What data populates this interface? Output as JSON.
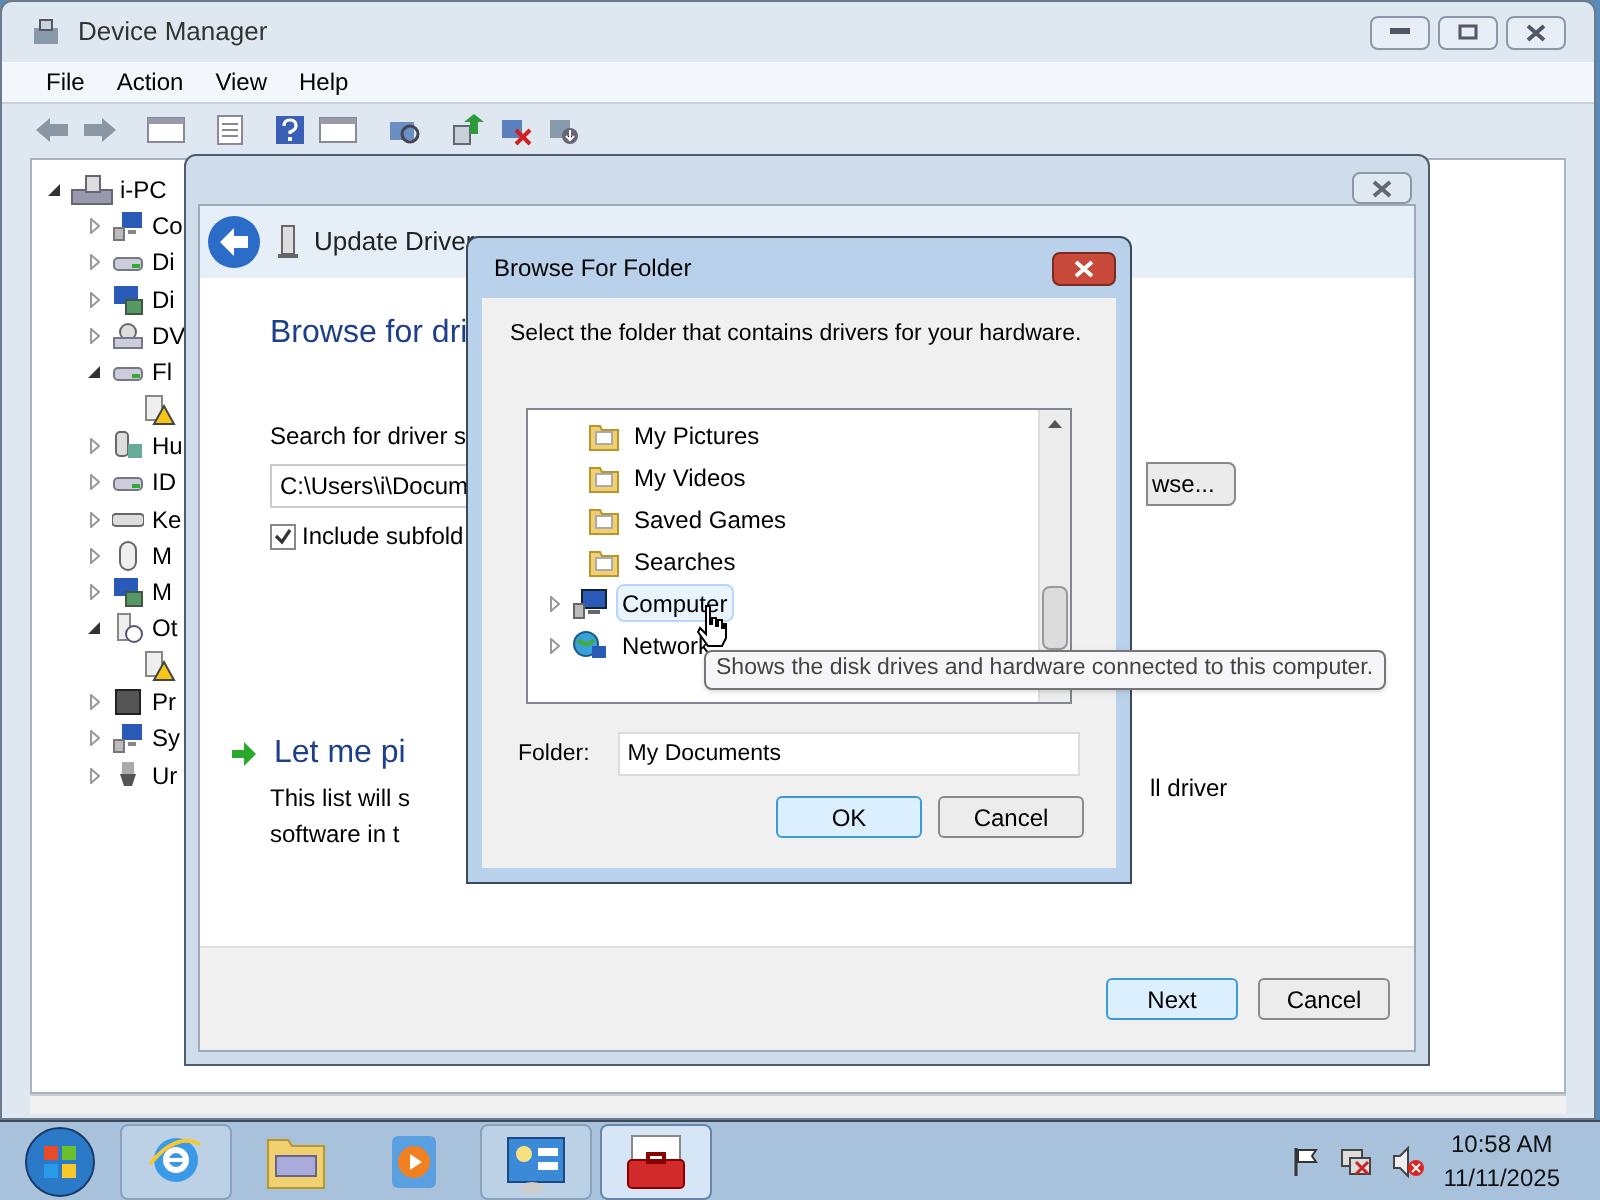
{
  "device_manager": {
    "title": "Device Manager",
    "menu": [
      "File",
      "Action",
      "View",
      "Help"
    ],
    "tree": {
      "label": "i-PC",
      "expanded": true,
      "children": [
        {
          "label": "Co",
          "kind": "computer",
          "expanded": false
        },
        {
          "label": "Di",
          "kind": "drive",
          "expanded": false
        },
        {
          "label": "Di",
          "kind": "display",
          "expanded": false
        },
        {
          "label": "DV",
          "kind": "dvd",
          "expanded": false
        },
        {
          "label": "Fl",
          "kind": "drive",
          "expanded": true,
          "children": [
            {
              "warning": true
            }
          ]
        },
        {
          "label": "Hu",
          "kind": "hid",
          "expanded": false
        },
        {
          "label": "ID",
          "kind": "drive",
          "expanded": false
        },
        {
          "label": "Ke",
          "kind": "keyboard",
          "expanded": false
        },
        {
          "label": "M",
          "kind": "mouse",
          "expanded": false
        },
        {
          "label": "M",
          "kind": "display",
          "expanded": false
        },
        {
          "label": "Ot",
          "kind": "unknown",
          "expanded": true,
          "children": [
            {
              "warning": true
            }
          ]
        },
        {
          "label": "Pr",
          "kind": "chip",
          "expanded": false
        },
        {
          "label": "Sy",
          "kind": "computer",
          "expanded": false
        },
        {
          "label": "Ur",
          "kind": "usb",
          "expanded": false
        }
      ]
    }
  },
  "wizard": {
    "title": "Update Driver",
    "heading": "Browse for dri",
    "search_label": "Search for driver s",
    "path": "C:\\Users\\i\\Docum",
    "browse_button": "wse...",
    "include_subfolders": {
      "label": "Include subfold",
      "checked": true
    },
    "pick_title": "Let me pi",
    "pick_line_1": "This list will s",
    "pick_line_1_end": "ll driver",
    "pick_line_2": "software in t",
    "buttons": [
      {
        "label": "Next",
        "default": true
      },
      {
        "label": "Cancel",
        "default": false
      }
    ]
  },
  "browse_dialog": {
    "title": "Browse For Folder",
    "prompt": "Select the folder that contains drivers for your hardware.",
    "items": [
      {
        "label": "My Pictures",
        "kind": "folder",
        "hovered": false
      },
      {
        "label": "My Videos",
        "kind": "folder",
        "hovered": false
      },
      {
        "label": "Saved Games",
        "kind": "folder",
        "hovered": false
      },
      {
        "label": "Searches",
        "kind": "folder",
        "hovered": false
      },
      {
        "label": "Computer",
        "kind": "computer",
        "hovered": true,
        "expanded": false
      },
      {
        "label": "Network",
        "kind": "network",
        "hovered": false,
        "expanded": false
      }
    ],
    "tooltip": "Shows the disk drives and hardware connected to this computer.",
    "folder_label": "Folder:",
    "folder_value": "My Documents",
    "buttons": [
      {
        "label": "OK",
        "default": true
      },
      {
        "label": "Cancel",
        "default": false
      }
    ]
  },
  "taskbar": {
    "time": "10:58 AM",
    "date": "11/11/2025",
    "apps": [
      {
        "running": true,
        "active": false
      },
      {
        "running": false,
        "active": false
      },
      {
        "running": false,
        "active": false
      },
      {
        "running": true,
        "active": false
      },
      {
        "running": true,
        "active": true
      }
    ]
  }
}
